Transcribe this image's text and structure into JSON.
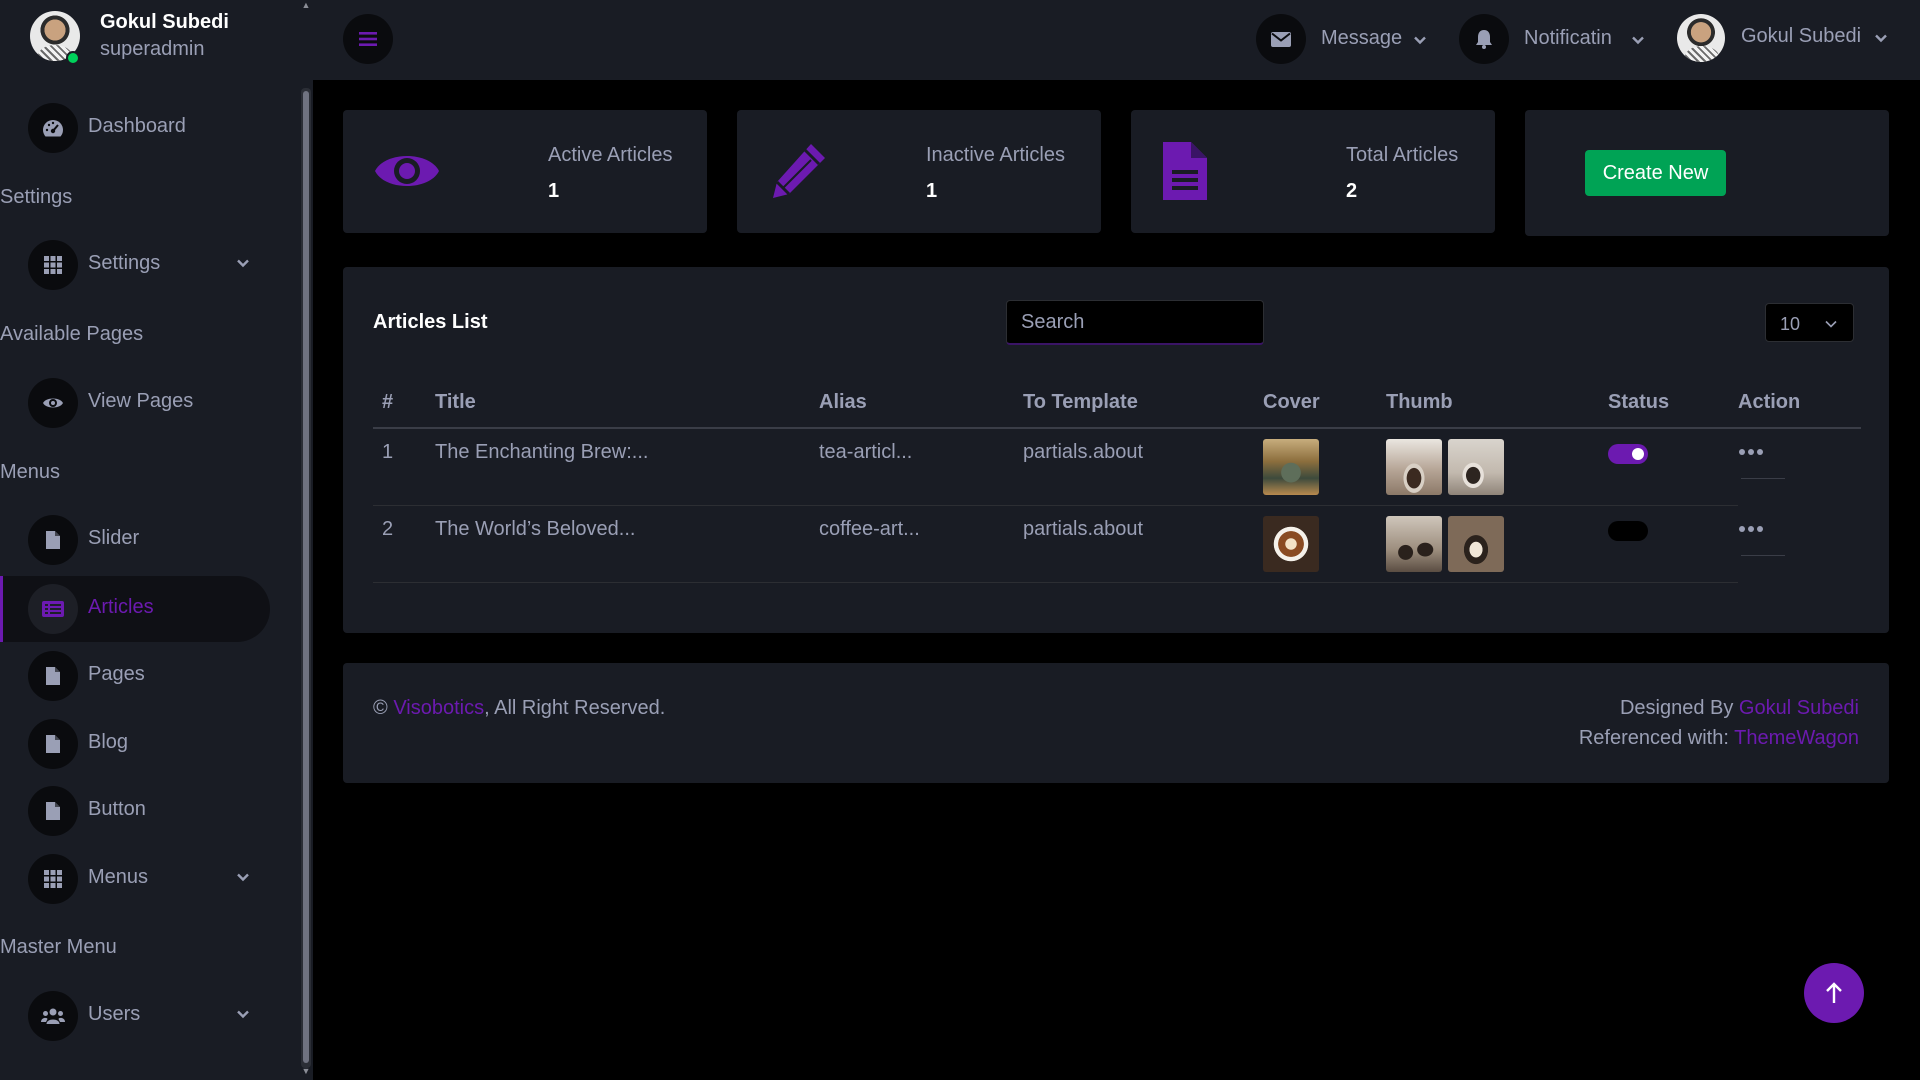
{
  "profile": {
    "name": "Gokul Subedi",
    "role": "superadmin"
  },
  "sidebar": {
    "dashboard": "Dashboard",
    "section_settings": "Settings",
    "settings": "Settings",
    "section_pages": "Available Pages",
    "view_pages": "View Pages",
    "section_menus": "Menus",
    "slider": "Slider",
    "articles": "Articles",
    "pages": "Pages",
    "blog": "Blog",
    "button": "Button",
    "menus": "Menus",
    "section_master": "Master Menu",
    "users": "Users"
  },
  "topbar": {
    "message": "Message",
    "notification": "Notificatin",
    "user": "Gokul Subedi"
  },
  "stats": {
    "active": {
      "title": "Active Articles",
      "value": "1"
    },
    "inactive": {
      "title": "Inactive Articles",
      "value": "1"
    },
    "total": {
      "title": "Total Articles",
      "value": "2"
    },
    "create_label": "Create New"
  },
  "list": {
    "title": "Articles List",
    "search_placeholder": "Search",
    "per_page": "10",
    "headers": {
      "num": "#",
      "title": "Title",
      "alias": "Alias",
      "template": "To Template",
      "cover": "Cover",
      "thumb": "Thumb",
      "status": "Status",
      "action": "Action"
    },
    "rows": [
      {
        "num": "1",
        "title": "The Enchanting Brew:...",
        "alias": "tea-articl...",
        "template": "partials.about",
        "status": true
      },
      {
        "num": "2",
        "title": "The World’s Beloved...",
        "alias": "coffee-art...",
        "template": "partials.about",
        "status": false
      }
    ]
  },
  "footer": {
    "copyright": "©",
    "brand": "Visobotics",
    "rights": ", All Right Reserved.",
    "designed_by": "Designed By",
    "designer": "Gokul Subedi",
    "referenced": "Referenced with:",
    "reference": "ThemeWagon"
  },
  "colors": {
    "accent": "#6c1ab0",
    "success": "#00a355",
    "panel": "#191c24",
    "background": "#000000"
  },
  "icons": {
    "dashboard": "speedometer-icon",
    "settings": "grid-icon",
    "view_pages": "eye-icon",
    "slider": "file-icon",
    "articles": "list-alt-icon",
    "menu_toggle": "hamburger-icon",
    "message": "envelope-icon",
    "notification": "bell-icon",
    "users": "users-icon",
    "back_to_top": "arrow-up-icon"
  }
}
